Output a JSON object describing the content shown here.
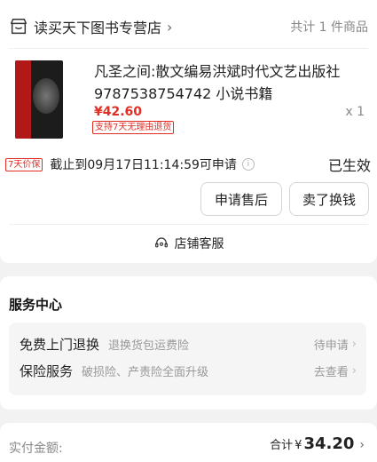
{
  "shop": {
    "name": "读买天下图书专营店",
    "count_text": "共计 1 件商品"
  },
  "product": {
    "title": "凡圣之间:散文编易洪斌时代文艺出版社9787538754742 小说书籍",
    "price": "¥42.60",
    "return_badge": "支持7天无理由退货",
    "quantity": "x 1"
  },
  "guarantee": {
    "badge": "7天价保",
    "deadline": "截止到09月17日11:14:59可申请",
    "status": "已生效"
  },
  "actions": {
    "after_sales": "申请售后",
    "sell": "卖了换钱"
  },
  "customer_service": {
    "label": "店铺客服"
  },
  "service_center": {
    "title": "服务中心",
    "rows": [
      {
        "name": "免费上门退换",
        "desc": "退换货包运费险",
        "action": "待申请"
      },
      {
        "name": "保险服务",
        "desc": "破损险、产责险全面升级",
        "action": "去查看"
      }
    ]
  },
  "payment": {
    "label": "实付金额:",
    "total_label": "合计",
    "currency": "¥",
    "amount": "34.20"
  }
}
